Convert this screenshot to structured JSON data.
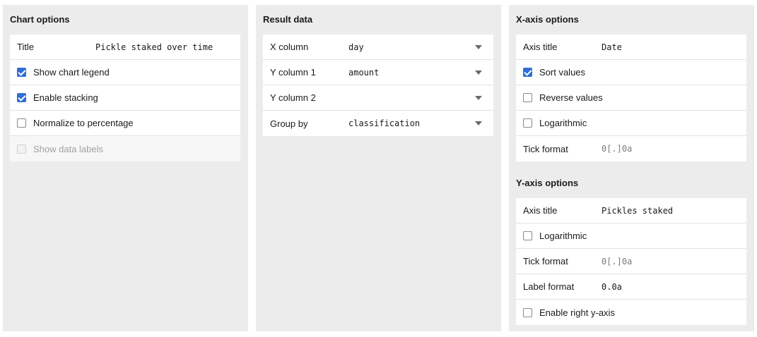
{
  "chart_options": {
    "heading": "Chart options",
    "title_label": "Title",
    "title_value": "Pickle staked over time",
    "show_legend": {
      "label": "Show chart legend",
      "checked": true
    },
    "enable_stacking": {
      "label": "Enable stacking",
      "checked": true
    },
    "normalize": {
      "label": "Normalize to percentage",
      "checked": false
    },
    "data_labels": {
      "label": "Show data labels",
      "checked": false,
      "disabled": true
    }
  },
  "result_data": {
    "heading": "Result data",
    "x_column": {
      "label": "X column",
      "value": "day"
    },
    "y_column_1": {
      "label": "Y column 1",
      "value": "amount"
    },
    "y_column_2": {
      "label": "Y column 2",
      "value": ""
    },
    "group_by": {
      "label": "Group by",
      "value": "classification"
    }
  },
  "x_axis": {
    "heading": "X-axis options",
    "axis_title_label": "Axis title",
    "axis_title_value": "Date",
    "sort_values": {
      "label": "Sort values",
      "checked": true
    },
    "reverse_values": {
      "label": "Reverse values",
      "checked": false
    },
    "logarithmic": {
      "label": "Logarithmic",
      "checked": false
    },
    "tick_format_label": "Tick format",
    "tick_format_placeholder": "0[.]0a"
  },
  "y_axis": {
    "heading": "Y-axis options",
    "axis_title_label": "Axis title",
    "axis_title_value": "Pickles staked",
    "logarithmic": {
      "label": "Logarithmic",
      "checked": false
    },
    "tick_format_label": "Tick format",
    "tick_format_placeholder": "0[.]0a",
    "label_format_label": "Label format",
    "label_format_value": "0.0a",
    "right_axis": {
      "label": "Enable right y-axis",
      "checked": false
    }
  },
  "colors": {
    "panel_bg": "#ececec",
    "accent": "#2f6fd6"
  }
}
